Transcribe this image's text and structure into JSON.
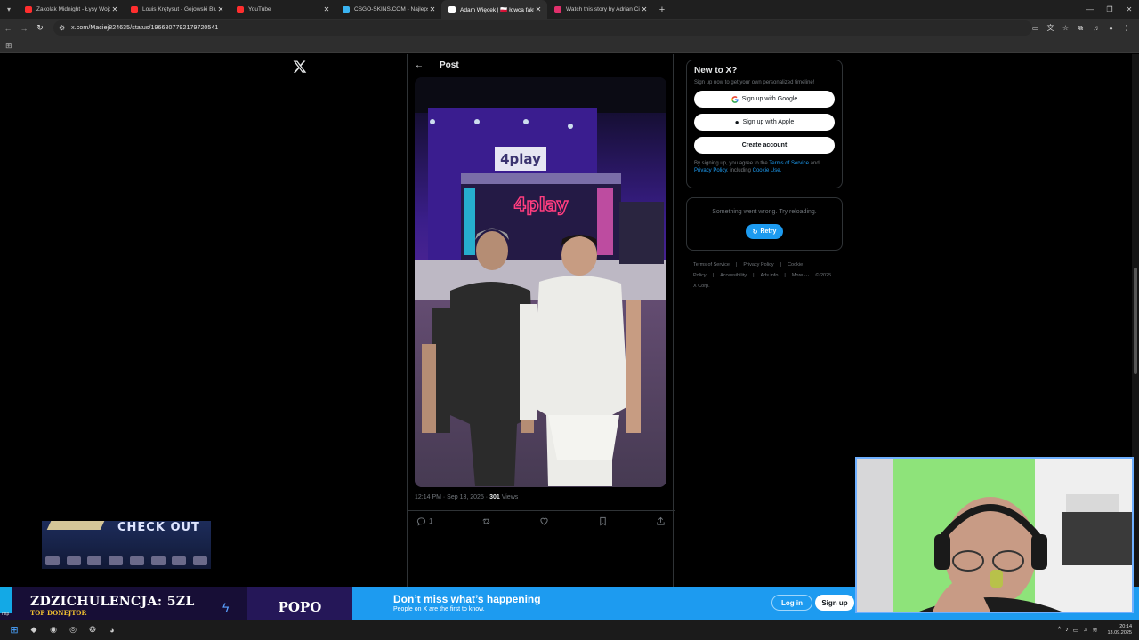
{
  "browser": {
    "tabs": [
      {
        "title": "Zakolak Midnight - Łysy Wojow",
        "favicon_color": "#ff2e2e",
        "active": false
      },
      {
        "title": "Louis Krętysut - Gejowski Blues",
        "favicon_color": "#ff2e2e",
        "active": false
      },
      {
        "title": "YouTube",
        "favicon_color": "#ff2e2e",
        "active": false
      },
      {
        "title": "CSGO-SKINS.COM - Najlepszy",
        "favicon_color": "#3ab4f2",
        "active": false
      },
      {
        "title": "Adam Więcek | 🇵🇱 łowca fakt",
        "favicon_color": "#ffffff",
        "active": true
      },
      {
        "title": "Watch this story by Adrian Cio",
        "favicon_color": "#e1306c",
        "active": false
      }
    ],
    "url": "x.com/Maciej824635/status/1966807792179720541"
  },
  "post": {
    "header_title": "Post",
    "timestamp": "12:14 PM · Sep 13, 2025 ·",
    "views_count": "301",
    "views_label": "Views",
    "reply_count": "1"
  },
  "sidebar": {
    "title": "New to X?",
    "subtitle": "Sign up now to get your own personalized timeline!",
    "google_label": "Sign up with Google",
    "apple_label": "Sign up with Apple",
    "create_label": "Create account",
    "legal_prefix": "By signing up, you agree to the",
    "terms_link": "Terms of Service",
    "legal_and": "and",
    "privacy_link": "Privacy Policy",
    "legal_including": ", including",
    "cookie_link": "Cookie Use.",
    "error_msg": "Something went wrong. Try reloading.",
    "retry_label": "Retry",
    "footer": [
      "Terms of Service",
      "|",
      "Privacy Policy",
      "|",
      "Cookie Policy",
      "|",
      "Accessibility",
      "|",
      "Ads info",
      "|",
      "More ···",
      "© 2025 X Corp."
    ]
  },
  "signup_banner": {
    "headline": "Don’t miss what’s happening",
    "sub": "People on X are the first to know.",
    "login_label": "Log in",
    "signup_label": "Sign up"
  },
  "stream_overlay": {
    "donation_text": "ZDZICHULENCJA: 5ZL",
    "donation_sub": "TOP DONEJTOR",
    "donor_name": "POPO",
    "ad_text": "CHECK OUT",
    "status_text": "http"
  },
  "taskbar": {
    "time": "20:14",
    "date": "13.09.2025"
  },
  "colors": {
    "accent": "#1d9bf0",
    "background": "#000000",
    "border": "#2f3336"
  }
}
